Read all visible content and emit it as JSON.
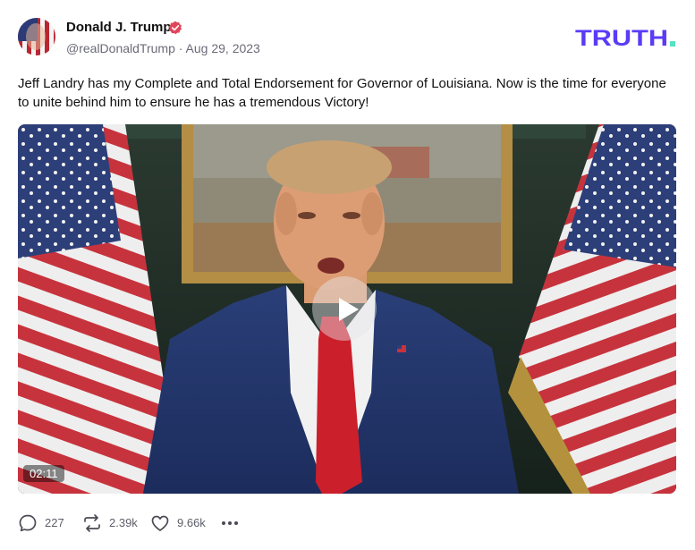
{
  "author": {
    "name": "Donald J. Trump",
    "handle": "@realDonaldTrump",
    "separator": "·",
    "date": "Aug 29, 2023",
    "verified_color": "#e0465a"
  },
  "brand": {
    "logo_text": "TRUTH.",
    "color": "#5b3bf6",
    "dot_color": "#56e3c3"
  },
  "post": {
    "text": "Jeff Landry has my Complete and Total Endorsement for Governor of Louisiana. Now is the time for everyone to unite behind him to ensure he has a tremendous Victory!"
  },
  "video": {
    "duration": "02:11",
    "play_icon": "play-icon"
  },
  "actions": {
    "replies": "227",
    "retruths": "2.39k",
    "likes": "9.66k",
    "icons": [
      "reply-icon",
      "retruth-icon",
      "heart-icon",
      "more-icon"
    ]
  }
}
